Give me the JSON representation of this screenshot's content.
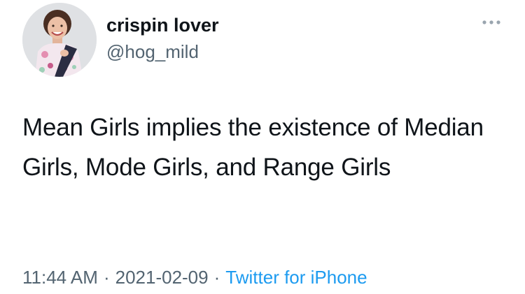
{
  "user": {
    "display_name": "crispin lover",
    "handle": "@hog_mild",
    "avatar_icon": "profile-photo"
  },
  "more_icon": "more-dots-icon",
  "tweet": {
    "text": "Mean Girls implies the existence of Median Girls, Mode Girls, and Range Girls"
  },
  "meta": {
    "time": "11:44 AM",
    "separator": "·",
    "date": "2021-02-09",
    "source": "Twitter for iPhone"
  },
  "colors": {
    "text_primary": "#0f1419",
    "text_secondary": "#536471",
    "link": "#1d9bf0"
  }
}
